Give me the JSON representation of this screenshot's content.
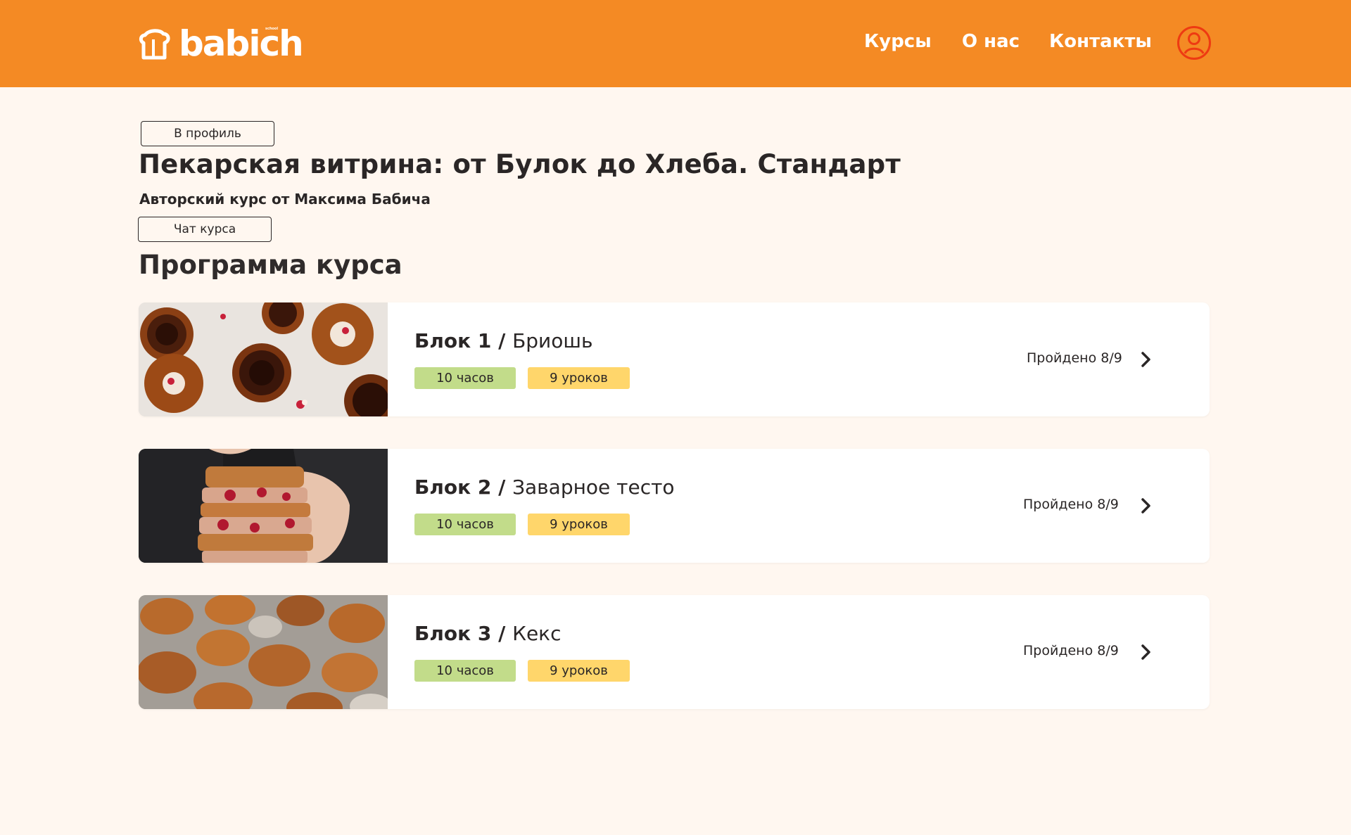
{
  "header": {
    "logo_text": "babich",
    "logo_sup": "school",
    "nav": [
      {
        "label": "Курсы"
      },
      {
        "label": "О нас"
      },
      {
        "label": "Контакты"
      }
    ],
    "profile_icon": "user-circle-icon"
  },
  "page": {
    "back_button": "В профиль",
    "course_title": "Пекарская витрина: от Булок до Хлеба. Стандарт",
    "course_author": "Авторский курс от Максима Бабича",
    "chat_button": "Чат курса",
    "program_title": "Программа курса"
  },
  "blocks": [
    {
      "number": "Блок 1",
      "separator": " / ",
      "name": "Бриошь",
      "hours": "10 часов",
      "lessons": "9 уроков",
      "progress": "Пройдено 8/9",
      "image": "brioche-photo"
    },
    {
      "number": "Блок 2",
      "separator": " / ",
      "name": "Заварное тесто",
      "hours": "10 часов",
      "lessons": "9 уроков",
      "progress": "Пройдено 8/9",
      "image": "eclair-photo"
    },
    {
      "number": "Блок 3",
      "separator": " / ",
      "name": "Кекс",
      "hours": "10 часов",
      "lessons": "9 уроков",
      "progress": "Пройдено 8/9",
      "image": "madeleine-photo"
    }
  ],
  "colors": {
    "header_bg": "#f48a24",
    "page_bg": "#fff7f0",
    "tag_hours": "#c2dc8a",
    "tag_lessons": "#ffd66b"
  }
}
